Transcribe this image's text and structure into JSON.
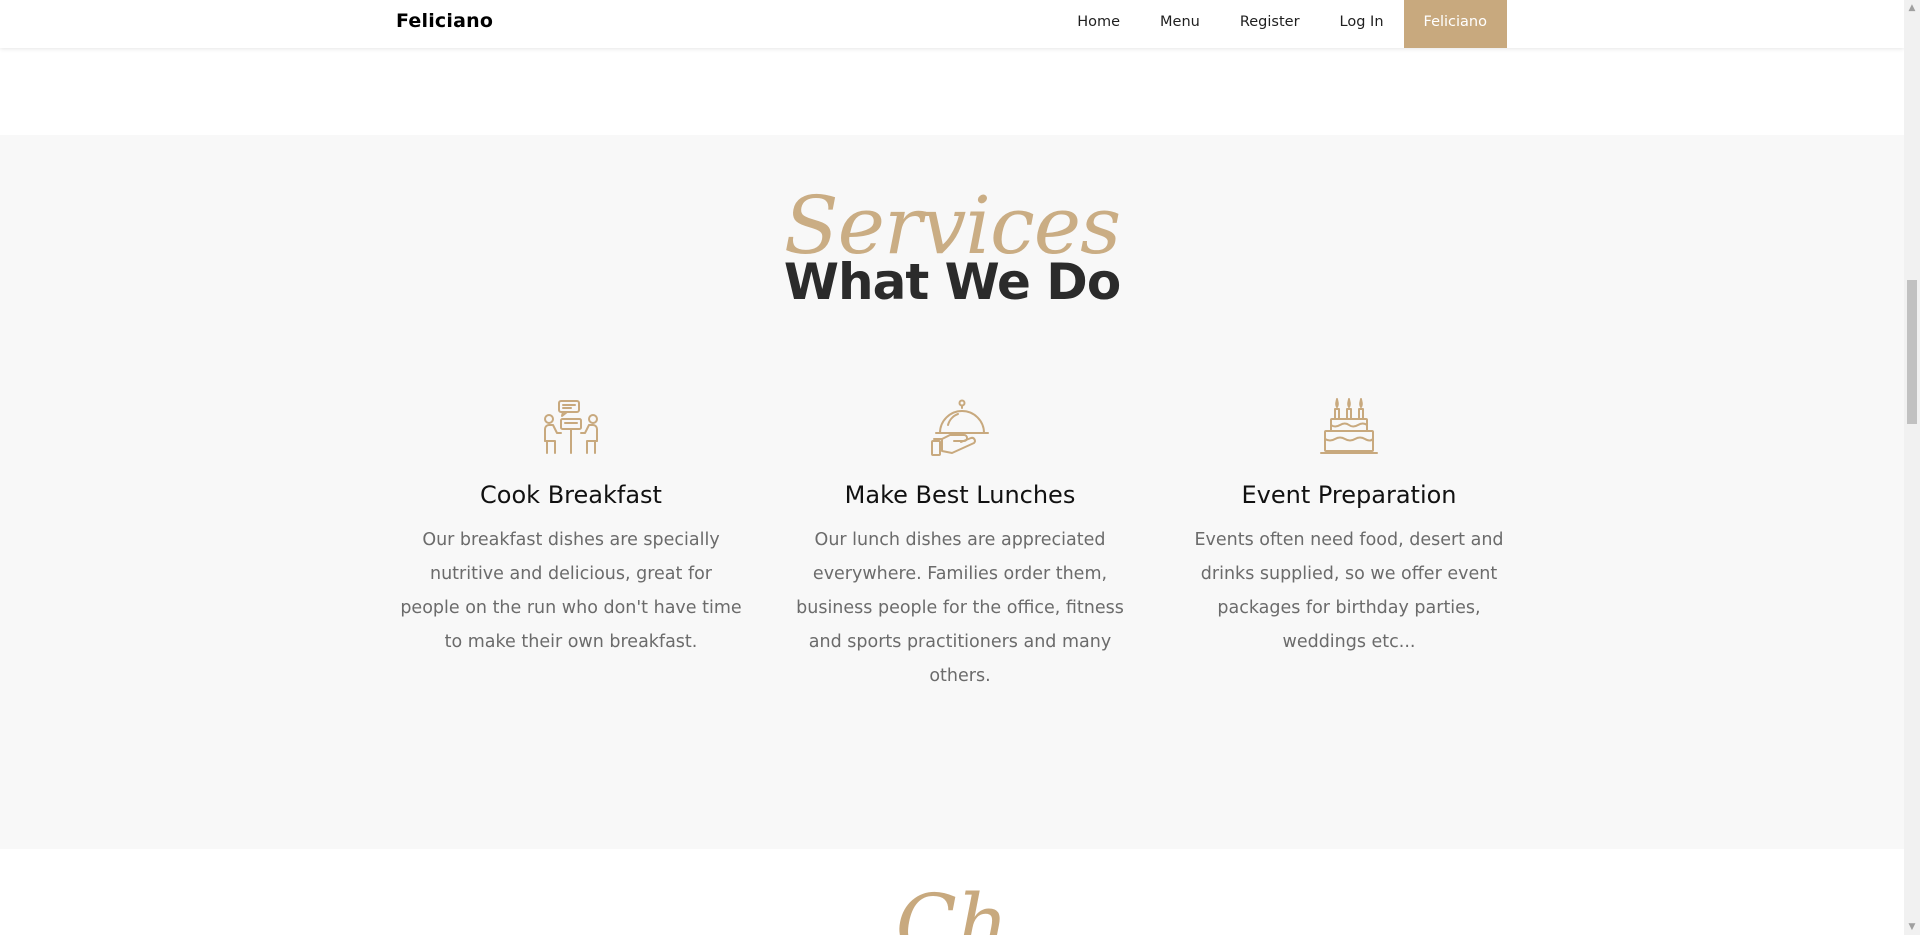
{
  "navbar": {
    "brand": "Feliciano",
    "links": [
      "Home",
      "Menu",
      "Register",
      "Log In"
    ],
    "cta": "Feliciano"
  },
  "services": {
    "script_title": "Services",
    "title": "What We Do",
    "cards": [
      {
        "icon": "dining-table-icon",
        "title": "Cook Breakfast",
        "text": "Our breakfast dishes are specially nutritive and delicious, great for people on the run who don't have time to make their own breakfast."
      },
      {
        "icon": "serving-cloche-icon",
        "title": "Make Best Lunches",
        "text": "Our lunch dishes are appreciated everywhere. Families order them, business people for the office, fitness and sports practitioners and many others."
      },
      {
        "icon": "birthday-cake-icon",
        "title": "Event Preparation",
        "text": "Events often need food, desert and drinks supplied, so we offer event packages for birthday parties, weddings etc..."
      }
    ]
  },
  "next_section": {
    "script_title_partial": "Ch"
  },
  "colors": {
    "accent": "#c8a97e",
    "section_bg": "#f8f8f8",
    "heading": "#2b2b2b",
    "body_text": "#6b6b6b"
  }
}
